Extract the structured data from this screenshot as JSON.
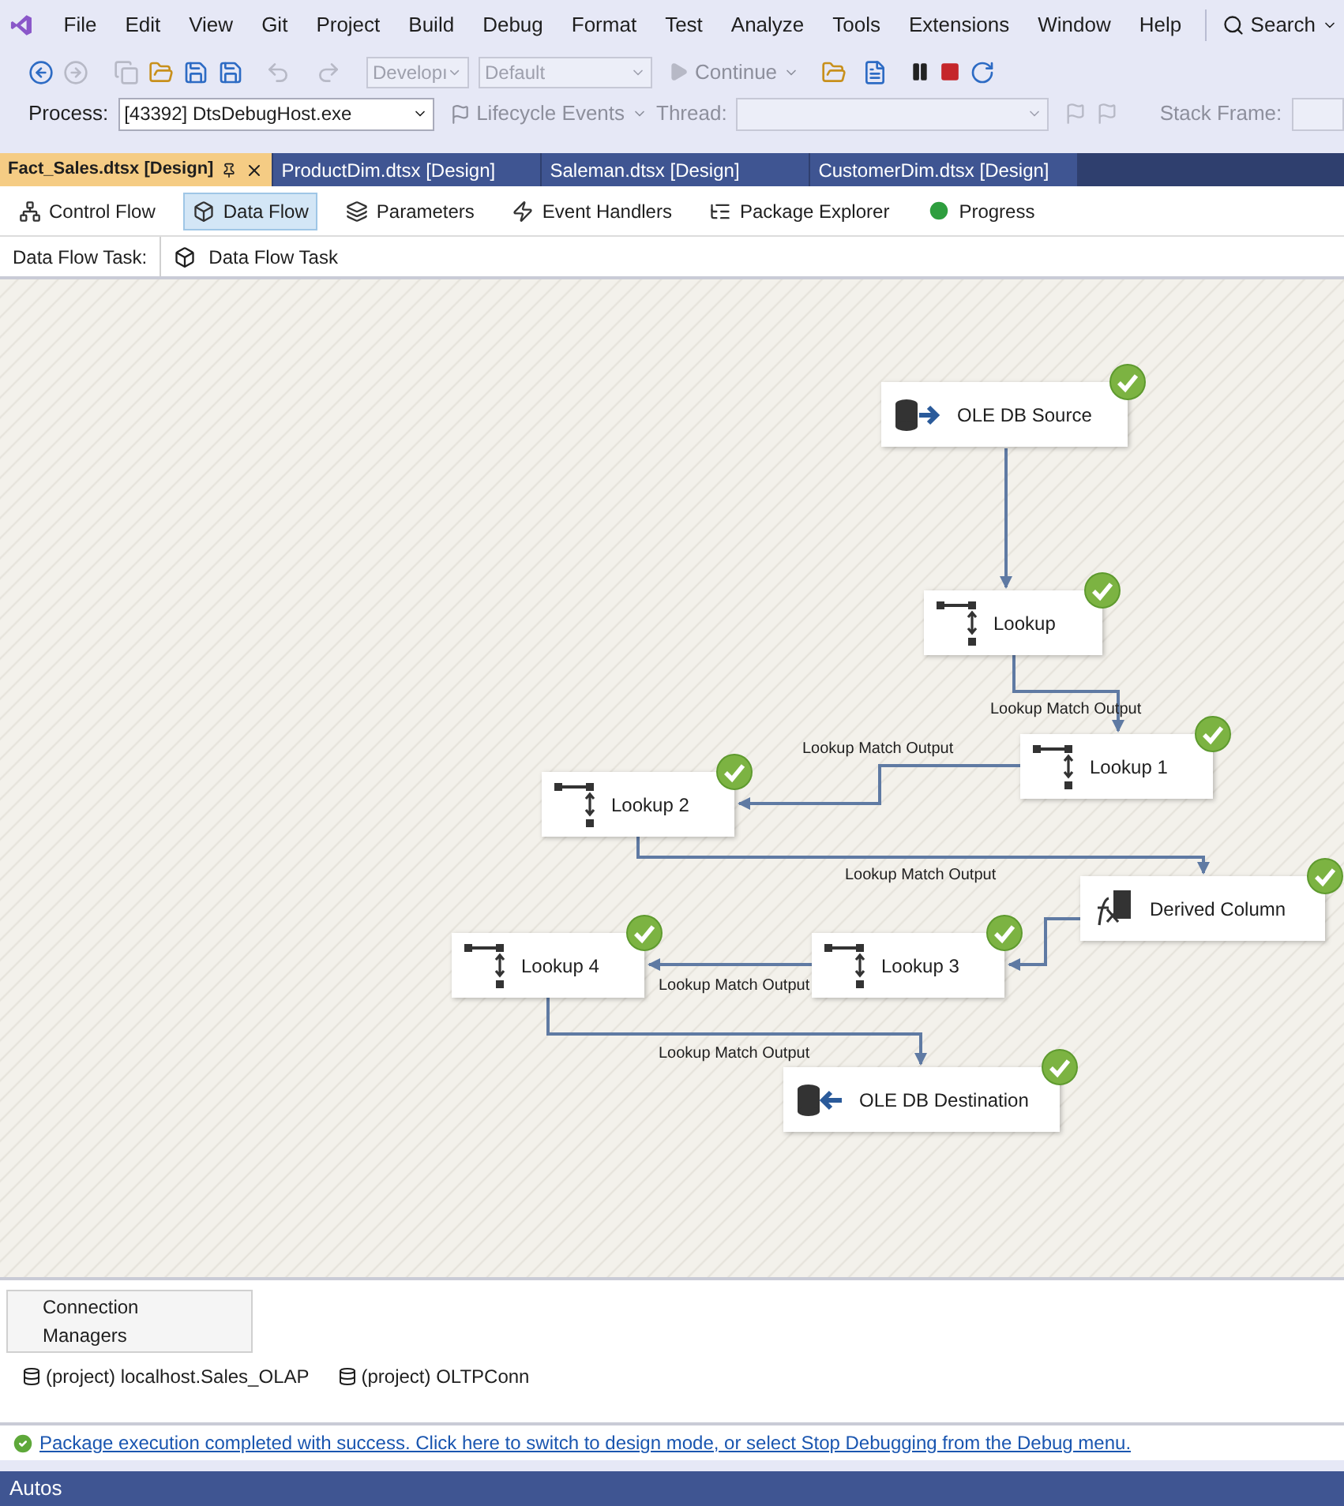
{
  "menu": {
    "items": [
      "File",
      "Edit",
      "View",
      "Git",
      "Project",
      "Build",
      "Debug",
      "Format",
      "Test",
      "Analyze",
      "Tools",
      "Extensions",
      "Window",
      "Help"
    ]
  },
  "search": {
    "label": "Search"
  },
  "toolbar": {
    "configuration": "Developı",
    "platform": "Default",
    "continue": "Continue"
  },
  "debug_bar": {
    "process_label": "Process:",
    "process": "[43392] DtsDebugHost.exe",
    "lifecycle": "Lifecycle Events",
    "thread_label": "Thread:",
    "stack_frame_label": "Stack Frame:"
  },
  "document_tabs": [
    {
      "label": "Fact_Sales.dtsx [Design]",
      "selected": true
    },
    {
      "label": "ProductDim.dtsx [Design]",
      "selected": false
    },
    {
      "label": "Saleman.dtsx [Design]",
      "selected": false
    },
    {
      "label": "CustomerDim.dtsx [Design]",
      "selected": false
    }
  ],
  "designer_tabs": [
    {
      "label": "Control Flow",
      "kind": "control",
      "selected": false
    },
    {
      "label": "Data Flow",
      "kind": "dataflow",
      "selected": true
    },
    {
      "label": "Parameters",
      "kind": "parameters",
      "selected": false
    },
    {
      "label": "Event Handlers",
      "kind": "events",
      "selected": false
    },
    {
      "label": "Package Explorer",
      "kind": "explorer",
      "selected": false
    },
    {
      "label": "Progress",
      "kind": "progress",
      "selected": false
    }
  ],
  "task": {
    "label": "Data Flow Task:",
    "value": "Data Flow Task"
  },
  "nodes": [
    {
      "label": "OLE DB Source",
      "kind": "source",
      "succeeded": true
    },
    {
      "label": "Lookup",
      "kind": "lookup",
      "succeeded": true
    },
    {
      "label": "Lookup 1",
      "kind": "lookup",
      "succeeded": true
    },
    {
      "label": "Lookup 2",
      "kind": "lookup",
      "succeeded": true
    },
    {
      "label": "Derived Column",
      "kind": "derived",
      "succeeded": true
    },
    {
      "label": "Lookup 3",
      "kind": "lookup",
      "succeeded": true
    },
    {
      "label": "Lookup 4",
      "kind": "lookup",
      "succeeded": true
    },
    {
      "label": "OLE DB Destination",
      "kind": "destination",
      "succeeded": true
    }
  ],
  "edges": [
    {
      "kind": "plain"
    },
    {
      "kind": "labeled",
      "label": "Lookup Match Output"
    },
    {
      "kind": "labeled",
      "label": "Lookup Match Output"
    },
    {
      "kind": "labeled",
      "label": "Lookup Match Output"
    },
    {
      "kind": "plain"
    },
    {
      "kind": "labeled",
      "label": "Lookup Match Output"
    },
    {
      "kind": "labeled",
      "label": "Lookup Match Output"
    }
  ],
  "connection_managers": {
    "title": "Connection Managers",
    "items": [
      "(project) localhost.Sales_OLAP",
      "(project) OLTPConn"
    ]
  },
  "status": {
    "message": "Package execution completed with success. Click here to switch to design mode, or select Stop Debugging from the Debug menu."
  },
  "bottom_panel": {
    "title": "Autos"
  }
}
